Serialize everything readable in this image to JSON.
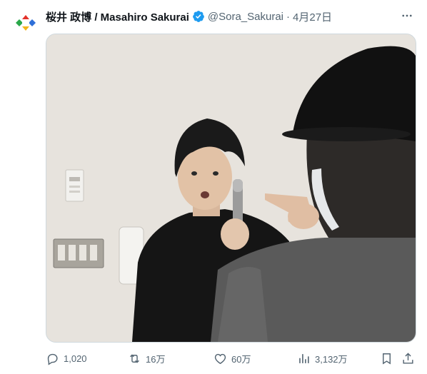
{
  "author": {
    "name": "桜井 政博 / Masahiro Sakurai",
    "handle": "@Sora_Sakurai",
    "separator": "·",
    "date": "4月27日"
  },
  "media": {
    "icon": "photo"
  },
  "actions": {
    "replies": "1,020",
    "reposts": "16万",
    "likes": "60万",
    "views": "3,132万"
  },
  "icons": {
    "verified": "verified-badge-icon",
    "more": "more-dots-icon",
    "reply": "reply-icon",
    "repost": "repost-icon",
    "like": "heart-icon",
    "views": "views-chart-icon",
    "bookmark": "bookmark-icon",
    "share": "share-icon"
  },
  "colors": {
    "accent": "#1d9bf0",
    "text": "#0f1419",
    "muted": "#536471",
    "border": "#cfd9de"
  }
}
